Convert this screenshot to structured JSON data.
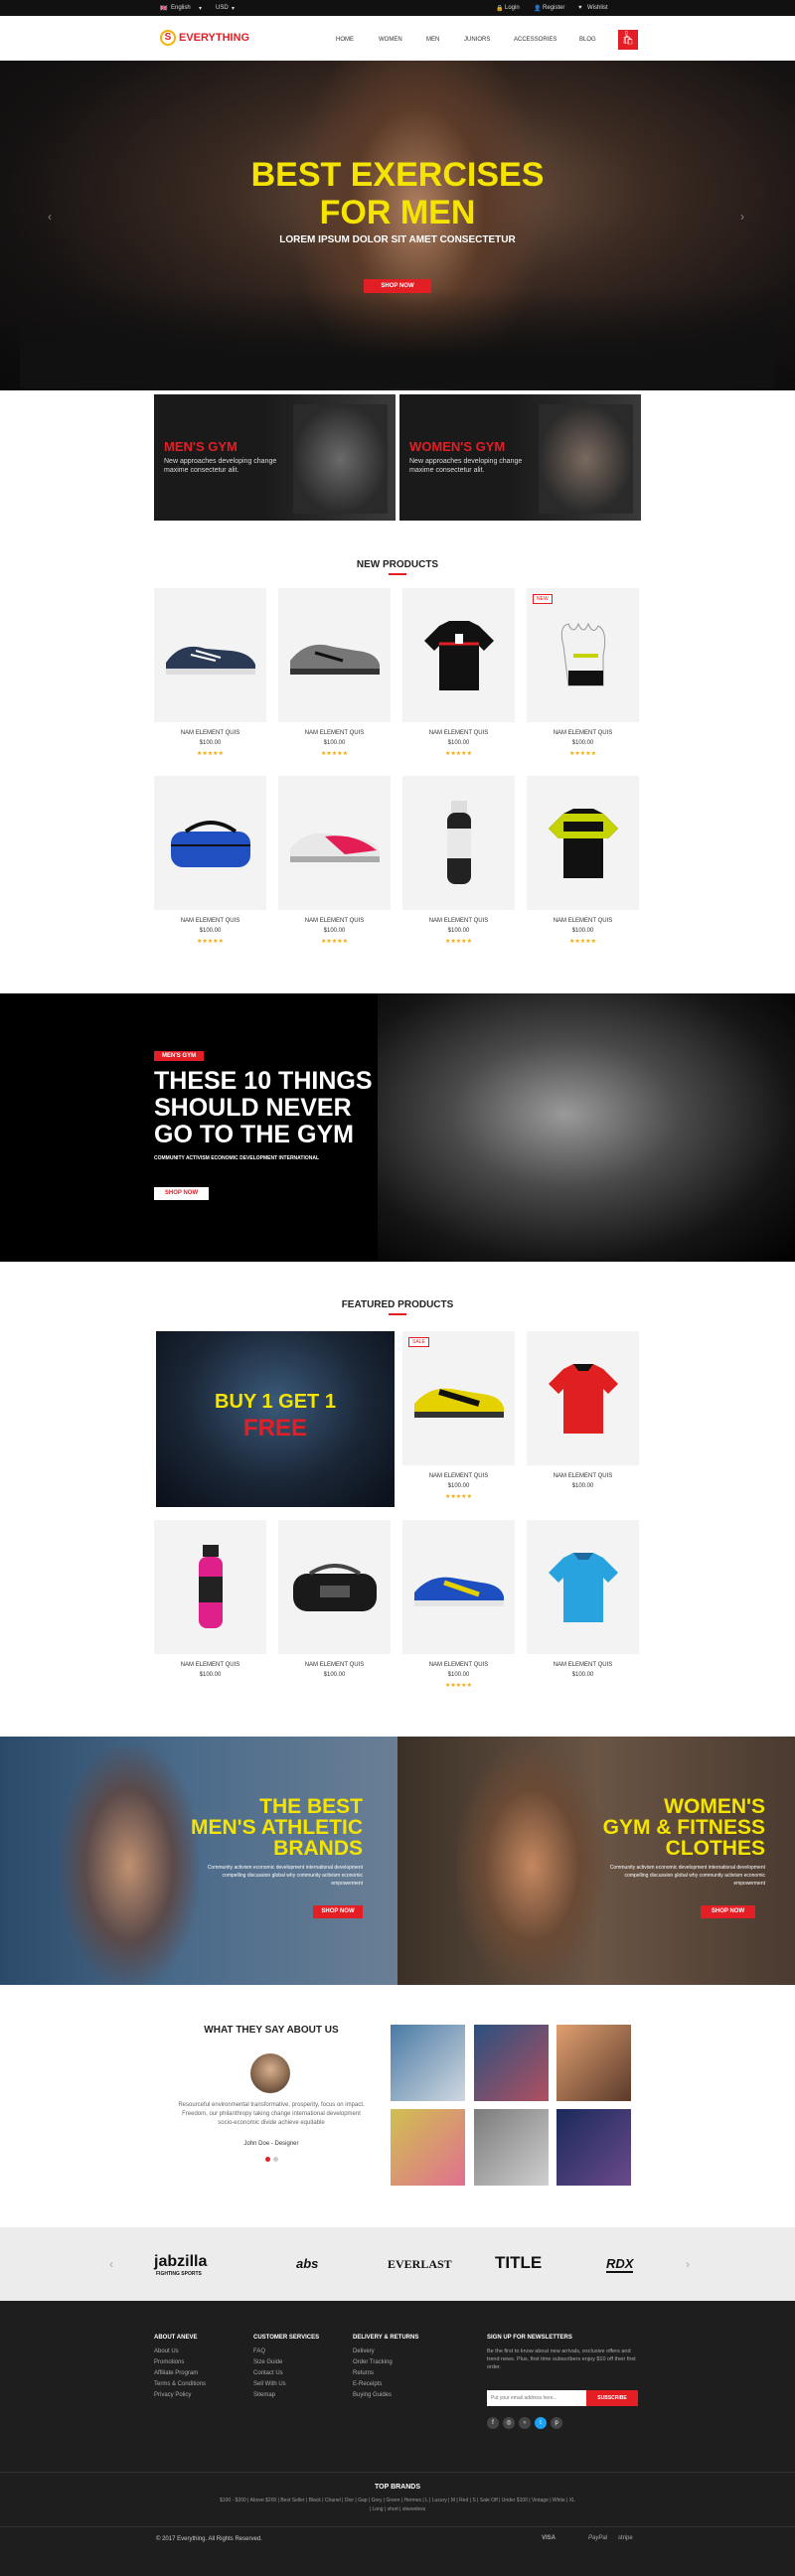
{
  "topbar": {
    "language": "English",
    "currency": "USD",
    "login": "Login",
    "register": "Register",
    "wishlist": "Wishlist"
  },
  "header": {
    "logo_text": "EVERYTHING",
    "logo_mark": "S",
    "nav": [
      "HOME",
      "WOMEN",
      "MEN",
      "JUNIORS",
      "ACCESSORIES",
      "BLOG"
    ],
    "cart_count": "0"
  },
  "hero": {
    "line1": "BEST EXERCISES",
    "line2": "FOR MEN",
    "subtitle": "LOREM IPSUM DOLOR SIT AMET CONSECTETUR",
    "button": "SHOP NOW"
  },
  "promos": [
    {
      "title": "MEN'S GYM",
      "text": "New approaches developing change maxime consectetur alit."
    },
    {
      "title": "WOMEN'S GYM",
      "text": "New approaches developing change maxime consectetur alit."
    }
  ],
  "new_products": {
    "title": "NEW PRODUCTS",
    "items": [
      {
        "name": "NAM ELEMENT QUIS",
        "price": "$100.00",
        "badge": ""
      },
      {
        "name": "NAM ELEMENT QUIS",
        "price": "$100.00",
        "badge": ""
      },
      {
        "name": "NAM ELEMENT QUIS",
        "price": "$100.00",
        "badge": ""
      },
      {
        "name": "NAM ELEMENT QUIS",
        "price": "$100.00",
        "badge": "NEW"
      },
      {
        "name": "NAM ELEMENT QUIS",
        "price": "$100.00",
        "badge": ""
      },
      {
        "name": "NAM ELEMENT QUIS",
        "price": "$100.00",
        "badge": ""
      },
      {
        "name": "NAM ELEMENT QUIS",
        "price": "$100.00",
        "badge": ""
      },
      {
        "name": "NAM ELEMENT QUIS",
        "price": "$100.00",
        "badge": ""
      }
    ],
    "stars": "★★★★★"
  },
  "banner": {
    "tag": "MEN'S GYM",
    "line1": "THESE 10 THINGS",
    "line2": "SHOULD NEVER",
    "line3": "GO TO THE GYM",
    "subtitle": "COMMUNITY ACTIVISM ECONOMIC DEVELOPMENT INTERNATIONAL",
    "button": "SHOP NOW"
  },
  "featured": {
    "title": "FEATURED PRODUCTS",
    "promo_line1": "BUY 1 GET 1",
    "promo_line2": "FREE",
    "items": [
      {
        "name": "NAM ELEMENT QUIS",
        "price": "$100.00",
        "badge": "SALE"
      },
      {
        "name": "NAM ELEMENT QUIS",
        "price": "$100.00",
        "badge": ""
      },
      {
        "name": "NAM ELEMENT QUIS",
        "price": "$100.00",
        "badge": ""
      },
      {
        "name": "NAM ELEMENT QUIS",
        "price": "$100.00",
        "badge": ""
      },
      {
        "name": "NAM ELEMENT QUIS",
        "price": "$100.00",
        "badge": ""
      },
      {
        "name": "NAM ELEMENT QUIS",
        "price": "$100.00",
        "badge": ""
      }
    ]
  },
  "split": [
    {
      "line1": "THE BEST",
      "line2": "MEN'S ATHLETIC",
      "line3": "BRANDS",
      "text": "Community activism economic development international development compelling discussion global why community activism economic empowerment",
      "button": "SHOP NOW"
    },
    {
      "line1": "WOMEN'S",
      "line2": "GYM & FITNESS",
      "line3": "CLOTHES",
      "text": "Community activism economic development international development compelling discussion global why community activism economic empowerment",
      "button": "SHOP NOW"
    }
  ],
  "testimonial": {
    "title": "WHAT THEY SAY ABOUT US",
    "quote": "Resourceful environmental transformative, prosperity, focus on impact. Freedom, our philanthropy taking change international development socio-economic divide achieve equitable",
    "author": "John Doe - Designer"
  },
  "brands": [
    "jabzilla",
    "abs",
    "EVERLAST",
    "TITLE",
    "RDX"
  ],
  "brands_sub": "FIGHTING SPORTS",
  "footer": {
    "columns": [
      {
        "title": "ABOUT ANEVE",
        "links": [
          "About Us",
          "Promotions",
          "Affiliate Program",
          "Terms & Conditions",
          "Privacy Policy"
        ]
      },
      {
        "title": "CUSTOMER SERVICES",
        "links": [
          "FAQ",
          "Size Guide",
          "Contact Us",
          "Sell With Us",
          "Sitemap"
        ]
      },
      {
        "title": "DELIVERY & RETURNS",
        "links": [
          "Delivery",
          "Order Tracking",
          "Returns",
          "E-Receipts",
          "Buying Guides"
        ]
      }
    ],
    "newsletter_title": "SIGN UP FOR NEWSLETTERS",
    "newsletter_text": "Be the first to know about new arrivals, exclusive offers and trend news. Plus, first time subscribers enjoy $10 off their first order.",
    "email_placeholder": "Put your email address here...",
    "subscribe": "SUBSCRIBE",
    "top_brands_title": "TOP BRANDS",
    "top_brands_line1": "$100 - $200 | Above $200 | Best Seller | Black | Chanel | Dior | Gap | Grey | Green | Hermes | L | Luxury | M | Red | S | Sale Off | Under $100 | Vintage | White | XL",
    "top_brands_line2": "| Long | short | sleeveless",
    "copyright": "© 2017 Everything. All Rights Reserved.",
    "payments": [
      "VISA",
      "PayPal",
      "stripe"
    ]
  }
}
